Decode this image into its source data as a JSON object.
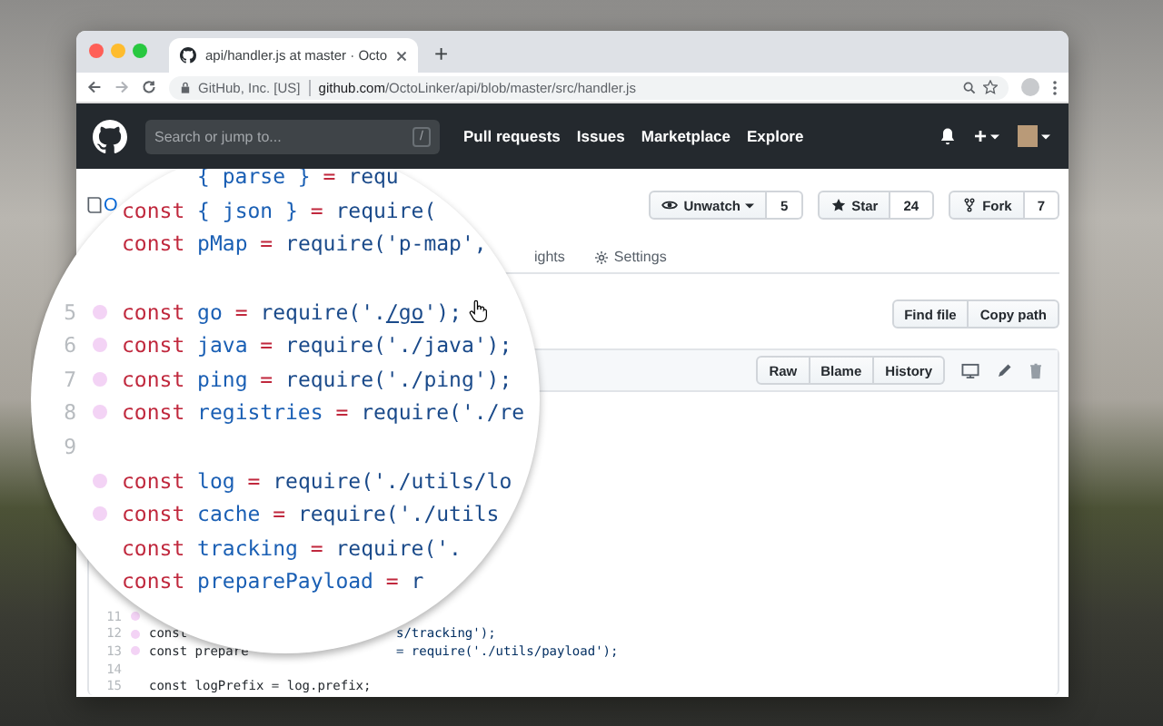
{
  "browser": {
    "tab_title": "api/handler.js at master · Octo",
    "new_tab": "+",
    "site_identity": "GitHub, Inc. [US]",
    "url_host": "github.com",
    "url_path": "/OctoLinker/api/blob/master/src/handler.js"
  },
  "header": {
    "search_placeholder": "Search or jump to...",
    "search_key": "/",
    "nav": [
      "Pull requests",
      "Issues",
      "Marketplace",
      "Explore"
    ],
    "new_menu": "+"
  },
  "repo": {
    "name": "O",
    "actions": [
      {
        "label": "Unwatch",
        "count": "5",
        "menu": true
      },
      {
        "label": "Star",
        "count": "24",
        "menu": false
      },
      {
        "label": "Fork",
        "count": "7",
        "menu": false
      }
    ],
    "tabs": [
      {
        "label": "ights",
        "selected": false
      },
      {
        "label": "Settings",
        "selected": false
      }
    ],
    "file_nav": [
      "Find file",
      "Copy path"
    ],
    "file_actions": [
      "Raw",
      "Blame",
      "History"
    ],
    "code": [
      {
        "number": "11",
        "linked": true
      },
      {
        "number": "12",
        "linked": true,
        "code": "const",
        "tail": "s/tracking');"
      },
      {
        "number": "13",
        "linked": true,
        "code": "const prepare",
        "tail": "= require('./utils/payload');"
      },
      {
        "number": "14",
        "linked": false
      },
      {
        "number": "15",
        "linked": false,
        "code": "const logPrefix = log.prefix;"
      }
    ]
  },
  "lens": {
    "lines": [
      {
        "kind": "partial",
        "parts": [
          {
            "text": "{ parse } ",
            "kind": "name"
          },
          {
            "text": "= ",
            "kind": "op"
          },
          {
            "text": "requ",
            "kind": "call"
          }
        ]
      },
      {
        "kind": "code",
        "parts": [
          {
            "text": "const",
            "kind": "keyword"
          },
          {
            "text": " { json } ",
            "kind": "name"
          },
          {
            "text": "= ",
            "kind": "op"
          },
          {
            "text": "require(",
            "kind": "call"
          }
        ]
      },
      {
        "kind": "code",
        "linked": false,
        "parts": [
          {
            "text": "const",
            "kind": "keyword"
          },
          {
            "text": " pMap ",
            "kind": "name"
          },
          {
            "text": "= ",
            "kind": "op"
          },
          {
            "text": "require('p-map',",
            "kind": "call"
          }
        ]
      },
      {
        "kind": "blank"
      },
      {
        "kind": "code",
        "number": "5",
        "linked": true,
        "parts": [
          {
            "text": "const",
            "kind": "keyword"
          },
          {
            "text": " go ",
            "kind": "name"
          },
          {
            "text": "= ",
            "kind": "op"
          },
          {
            "text": "require('.",
            "kind": "call"
          },
          {
            "text": "/go",
            "kind": "link"
          },
          {
            "text": "');",
            "kind": "call"
          }
        ]
      },
      {
        "kind": "code",
        "number": "6",
        "linked": true,
        "parts": [
          {
            "text": "const",
            "kind": "keyword"
          },
          {
            "text": " java ",
            "kind": "name"
          },
          {
            "text": "= ",
            "kind": "op"
          },
          {
            "text": "require('./java');",
            "kind": "call"
          }
        ]
      },
      {
        "kind": "code",
        "number": "7",
        "linked": true,
        "parts": [
          {
            "text": "const",
            "kind": "keyword"
          },
          {
            "text": " ping ",
            "kind": "name"
          },
          {
            "text": "= ",
            "kind": "op"
          },
          {
            "text": "require('./ping');",
            "kind": "call"
          }
        ]
      },
      {
        "kind": "code",
        "number": "8",
        "linked": true,
        "parts": [
          {
            "text": "const",
            "kind": "keyword"
          },
          {
            "text": " registries ",
            "kind": "name"
          },
          {
            "text": "= ",
            "kind": "op"
          },
          {
            "text": "require('./re",
            "kind": "call"
          }
        ]
      },
      {
        "kind": "blank",
        "number": "9"
      },
      {
        "kind": "code",
        "linked": true,
        "parts": [
          {
            "text": "const",
            "kind": "keyword"
          },
          {
            "text": " log ",
            "kind": "name"
          },
          {
            "text": "= ",
            "kind": "op"
          },
          {
            "text": "require('./utils/lo",
            "kind": "call"
          }
        ]
      },
      {
        "kind": "code",
        "linked": true,
        "parts": [
          {
            "text": "const",
            "kind": "keyword"
          },
          {
            "text": " cache ",
            "kind": "name"
          },
          {
            "text": "= ",
            "kind": "op"
          },
          {
            "text": "require('./utils",
            "kind": "call"
          }
        ]
      },
      {
        "kind": "code",
        "parts": [
          {
            "text": "const",
            "kind": "keyword"
          },
          {
            "text": " tracking ",
            "kind": "name"
          },
          {
            "text": "= ",
            "kind": "op"
          },
          {
            "text": "require('.",
            "kind": "call"
          }
        ]
      },
      {
        "kind": "code",
        "parts": [
          {
            "text": "const",
            "kind": "keyword"
          },
          {
            "text": " preparePayload ",
            "kind": "name"
          },
          {
            "text": "= ",
            "kind": "op"
          },
          {
            "text": "r",
            "kind": "call"
          }
        ]
      }
    ]
  }
}
